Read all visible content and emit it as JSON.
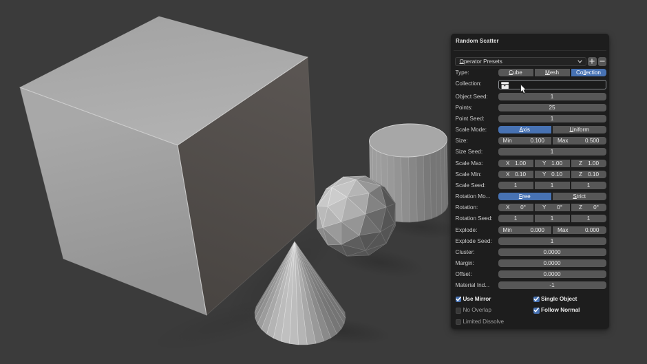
{
  "viewport": {
    "background": "#3b3b3b",
    "objects": [
      "cube",
      "cone",
      "icosphere",
      "cylinder"
    ]
  },
  "panel": {
    "title": "Random Scatter",
    "presets": {
      "label": "Operator Presets",
      "add_label": "+",
      "remove_label": "−"
    },
    "accent_color": "#4772b3",
    "rows": [
      {
        "label": "Type:",
        "widget": {
          "kind": "segmented",
          "buttons": [
            {
              "text": "Cube",
              "ul": [
                0,
                1
              ],
              "active": false
            },
            {
              "text": "Mesh",
              "ul": [
                0,
                1
              ],
              "active": false
            },
            {
              "text": "Collection",
              "ul": [
                2,
                2
              ],
              "active": true
            }
          ]
        }
      },
      {
        "label": "Collection:",
        "widget": {
          "kind": "pointer",
          "icon": "collection-icon",
          "value": ""
        }
      },
      {
        "label": "Object Seed:",
        "widget": {
          "kind": "number",
          "value": "1"
        }
      },
      {
        "label": "Points:",
        "widget": {
          "kind": "number",
          "value": "25"
        }
      },
      {
        "label": "Point Seed:",
        "widget": {
          "kind": "number",
          "value": "1"
        }
      },
      {
        "label": "Scale Mode:",
        "widget": {
          "kind": "segmented",
          "buttons": [
            {
              "text": "Axis",
              "ul": [
                0,
                1
              ],
              "active": true
            },
            {
              "text": "Uniform",
              "ul": [
                0,
                1
              ],
              "active": false
            }
          ]
        }
      },
      {
        "label": "Size:",
        "widget": {
          "kind": "pairs",
          "items": [
            {
              "k": "Min",
              "v": "0.100"
            },
            {
              "k": "Max",
              "v": "0.500"
            }
          ]
        }
      },
      {
        "label": "Size Seed:",
        "widget": {
          "kind": "number",
          "value": "1"
        }
      },
      {
        "label": "Scale Max:",
        "widget": {
          "kind": "pairs",
          "items": [
            {
              "k": "X",
              "v": "1.00"
            },
            {
              "k": "Y",
              "v": "1.00"
            },
            {
              "k": "Z",
              "v": "1.00"
            }
          ]
        }
      },
      {
        "label": "Scale Min:",
        "widget": {
          "kind": "pairs",
          "items": [
            {
              "k": "X",
              "v": "0.10"
            },
            {
              "k": "Y",
              "v": "0.10"
            },
            {
              "k": "Z",
              "v": "0.10"
            }
          ]
        }
      },
      {
        "label": "Scale Seed:",
        "widget": {
          "kind": "multi",
          "values": [
            "1",
            "1",
            "1"
          ]
        }
      },
      {
        "label": "Rotation Mo...",
        "widget": {
          "kind": "segmented",
          "buttons": [
            {
              "text": "Free",
              "ul": [
                0,
                1
              ],
              "active": true
            },
            {
              "text": "Strict",
              "ul": [
                0,
                1
              ],
              "active": false
            }
          ]
        }
      },
      {
        "label": "Rotation:",
        "widget": {
          "kind": "pairs",
          "items": [
            {
              "k": "X",
              "v": "0°"
            },
            {
              "k": "Y",
              "v": "0°"
            },
            {
              "k": "Z",
              "v": "0°"
            }
          ]
        }
      },
      {
        "label": "Rotation Seed:",
        "widget": {
          "kind": "multi",
          "values": [
            "1",
            "1",
            "1"
          ]
        }
      },
      {
        "label": "Explode:",
        "widget": {
          "kind": "pairs",
          "items": [
            {
              "k": "Min",
              "v": "0.000"
            },
            {
              "k": "Max",
              "v": "0.000"
            }
          ]
        }
      },
      {
        "label": "Explode Seed:",
        "widget": {
          "kind": "number",
          "value": "1"
        }
      },
      {
        "label": "Cluster:",
        "widget": {
          "kind": "number",
          "value": "0.0000"
        }
      },
      {
        "label": "Margin:",
        "widget": {
          "kind": "number",
          "value": "0.0000"
        }
      },
      {
        "label": "Offset:",
        "widget": {
          "kind": "number",
          "value": "0.0000"
        }
      },
      {
        "label": "Material Ind...",
        "widget": {
          "kind": "number",
          "value": "-1"
        }
      }
    ],
    "checkbox_rows": [
      [
        {
          "label": "Use Mirror",
          "checked": true
        },
        {
          "label": "Single Object",
          "checked": true
        }
      ],
      [
        {
          "label": "No Overlap",
          "checked": false
        },
        {
          "label": "Follow Normal",
          "checked": true
        }
      ],
      [
        {
          "label": "Limited Dissolve",
          "checked": false
        }
      ]
    ]
  }
}
